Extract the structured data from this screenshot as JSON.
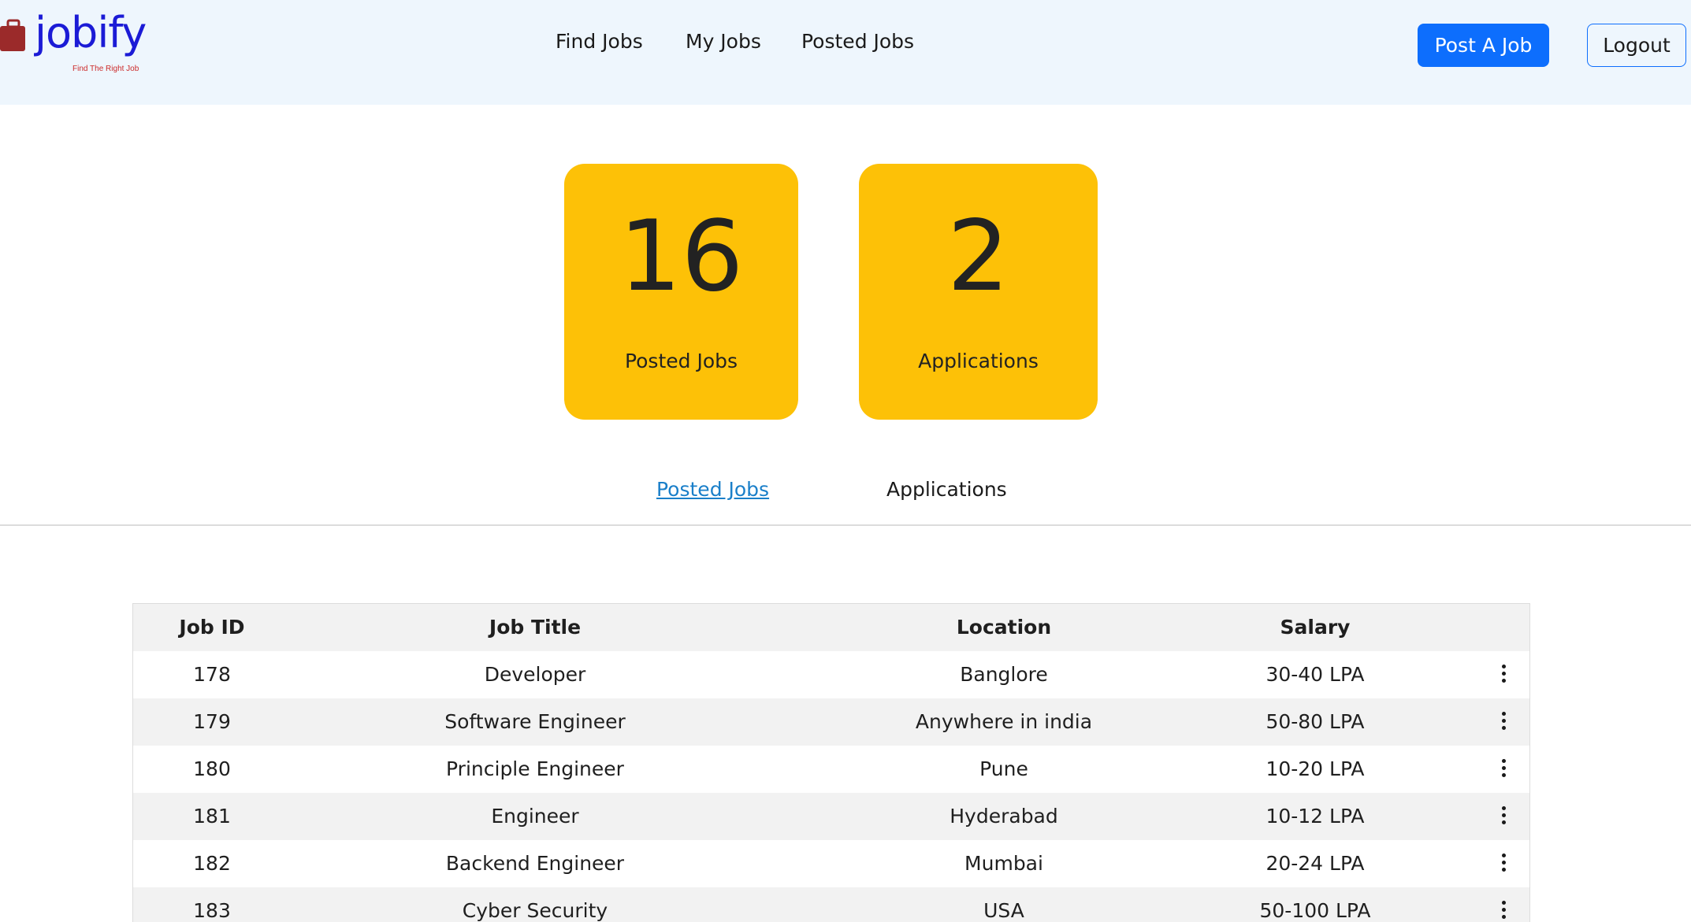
{
  "brand": {
    "name": "jobify",
    "tagline": "Find The Right Job",
    "colors": {
      "text": "#1b1bd6",
      "tagline": "#cc2a2a",
      "icon": "#9b2a2a"
    }
  },
  "nav": {
    "items": [
      {
        "label": "Find Jobs"
      },
      {
        "label": "My Jobs"
      },
      {
        "label": "Posted Jobs"
      }
    ]
  },
  "actions": {
    "post_job": "Post A Job",
    "logout": "Logout"
  },
  "stats": [
    {
      "value": "16",
      "label": "Posted Jobs"
    },
    {
      "value": "2",
      "label": "Applications"
    }
  ],
  "tabs": [
    {
      "label": "Posted Jobs",
      "active": true
    },
    {
      "label": "Applications",
      "active": false
    }
  ],
  "table": {
    "headers": [
      "Job ID",
      "Job Title",
      "Location",
      "Salary"
    ],
    "rows": [
      {
        "id": "178",
        "title": "Developer",
        "location": "Banglore",
        "salary": "30-40 LPA"
      },
      {
        "id": "179",
        "title": "Software Engineer",
        "location": "Anywhere in india",
        "salary": "50-80 LPA"
      },
      {
        "id": "180",
        "title": "Principle Engineer",
        "location": "Pune",
        "salary": "10-20 LPA"
      },
      {
        "id": "181",
        "title": "Engineer",
        "location": "Hyderabad",
        "salary": "10-12 LPA"
      },
      {
        "id": "182",
        "title": "Backend Engineer",
        "location": "Mumbai",
        "salary": "20-24 LPA"
      },
      {
        "id": "183",
        "title": "Cyber Security",
        "location": "USA",
        "salary": "50-100 LPA"
      }
    ]
  },
  "colors": {
    "header_bg": "#eef6fd",
    "primary": "#0d6efd",
    "card": "#fdc107",
    "active_tab": "#1a7fc9",
    "row_alt": "#f2f2f2"
  }
}
